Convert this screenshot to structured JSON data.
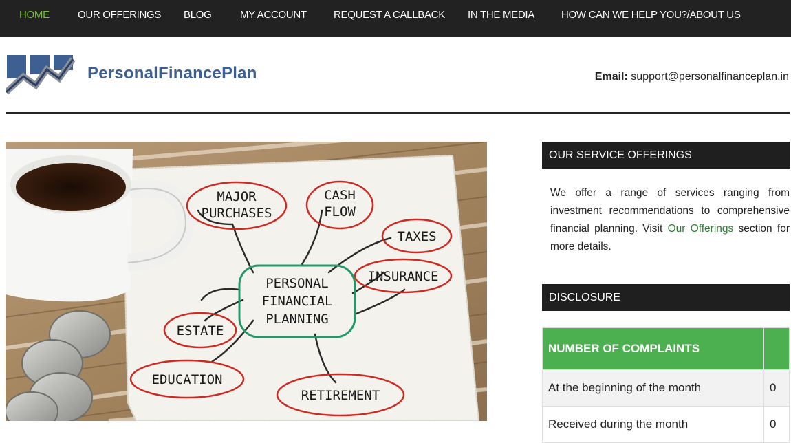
{
  "nav": {
    "items": [
      {
        "label": "HOME",
        "active": true
      },
      {
        "label": "OUR OFFERINGS",
        "active": false
      },
      {
        "label": "BLOG",
        "active": false
      },
      {
        "label": "MY ACCOUNT",
        "active": false
      },
      {
        "label": "REQUEST A CALLBACK",
        "active": false
      },
      {
        "label": "IN THE MEDIA",
        "active": false
      },
      {
        "label": "HOW CAN WE HELP YOU?/ABOUT US",
        "active": false
      }
    ]
  },
  "header": {
    "logo_text": "PersonalFinancePlan",
    "email_label": "Email:",
    "email": "support@personalfinanceplan.in"
  },
  "hero": {
    "center": [
      "PERSONAL",
      "FINANCIAL",
      "PLANNING"
    ],
    "bubbles": {
      "major": [
        "MAJOR",
        "PURCHASES"
      ],
      "cash": [
        "CASH",
        "FLOW"
      ],
      "taxes": "TAXES",
      "insurance": "INSURANCE",
      "estate": "ESTATE",
      "education": "EDUCATION",
      "retirement": "RETIREMENT"
    }
  },
  "sidebar": {
    "services_title": "OUR SERVICE OFFERINGS",
    "services_text_before": "We offer a range of services ranging from investment recommendations to comprehensive financial planning. Visit ",
    "services_link": "Our Offerings",
    "services_text_after": " section for more details.",
    "disclosure_title": "DISCLOSURE",
    "complaints": {
      "header": "NUMBER OF COMPLAINTS",
      "header_value": "",
      "rows": [
        {
          "label": "At the beginning of the month",
          "value": "0"
        },
        {
          "label": "Received during the month",
          "value": "0"
        }
      ]
    }
  },
  "colors": {
    "nav_bg": "#222222",
    "nav_active": "#7cba3f",
    "brand_blue": "#3d5f91",
    "table_header": "#4caf50",
    "link_green": "#2e7d32"
  }
}
